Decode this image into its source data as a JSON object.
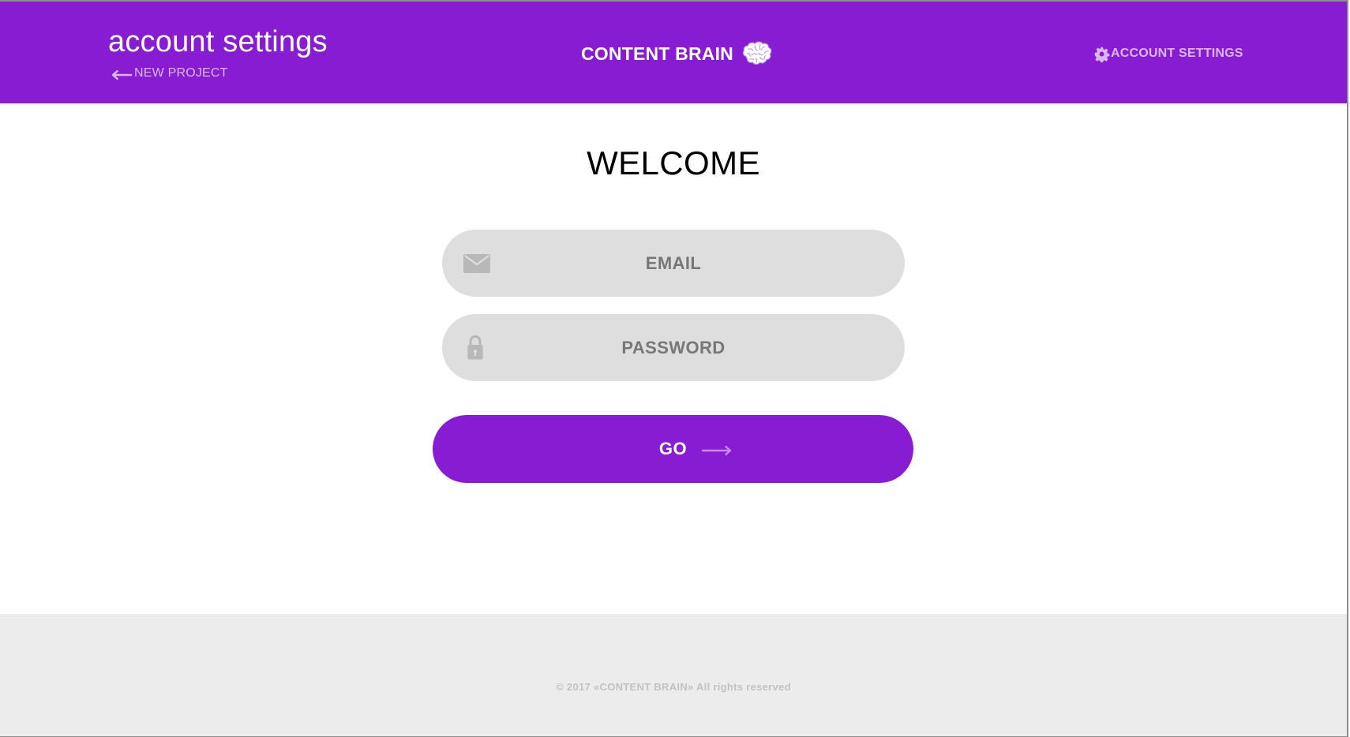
{
  "header": {
    "page_title": "account settings",
    "back_link_label": "NEW PROJECT",
    "brand_name": "CONTENT BRAIN",
    "account_link_label": "ACCOUNT SETTINGS",
    "icons": {
      "back": "arrow-left-icon",
      "brand": "brain-icon",
      "account": "gear-icon"
    }
  },
  "main": {
    "welcome_heading": "WELCOME",
    "email_field": {
      "value": "",
      "placeholder": "EMAIL",
      "icon": "envelope-icon"
    },
    "password_field": {
      "value": "",
      "placeholder": "PASSWORD",
      "icon": "lock-icon"
    },
    "go_button": {
      "label": "GO",
      "icon": "arrow-right-icon"
    }
  },
  "footer": {
    "copyright": "© 2017 «CONTENT BRAIN» All rights reserved"
  },
  "colors": {
    "brand_purple": "#871cd2",
    "header_muted_text": "#d7b8ee",
    "input_background": "#dedede",
    "input_text": "#777777",
    "footer_background": "#ececec",
    "footer_text": "#c2c2c2",
    "heading_text": "#000000"
  }
}
